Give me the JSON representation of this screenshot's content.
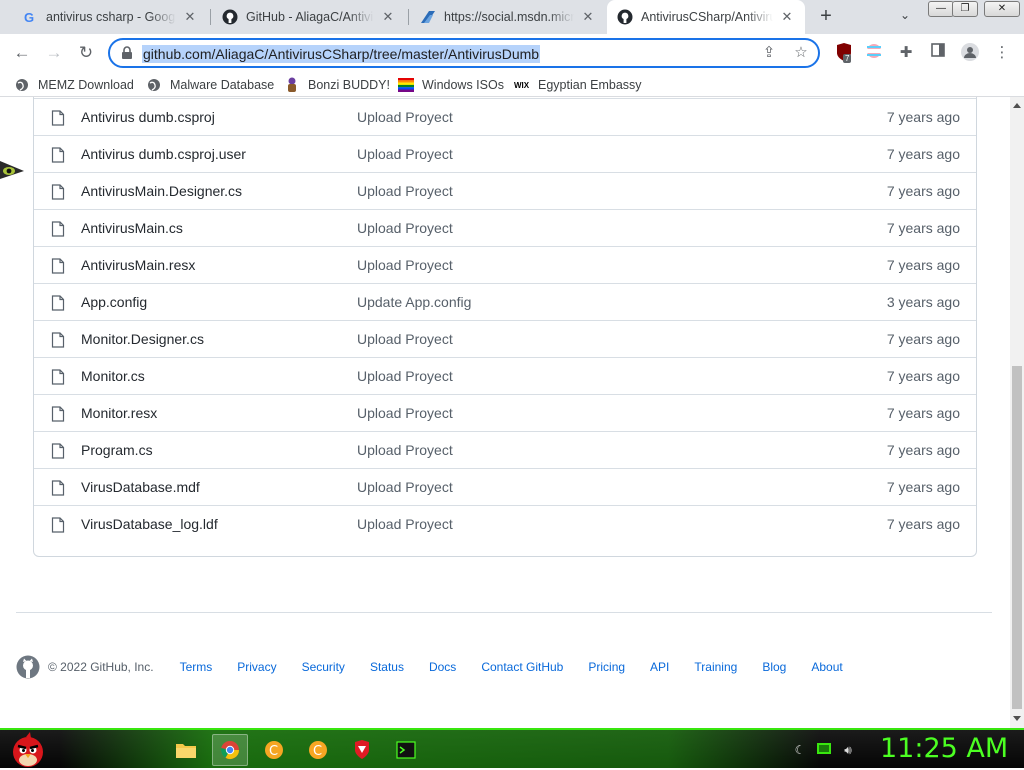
{
  "browser": {
    "tabs": [
      {
        "title": "antivirus csharp - Google",
        "favicon": "google-icon"
      },
      {
        "title": "GitHub - AliagaC/Antivirus",
        "favicon": "github-icon"
      },
      {
        "title": "https://social.msdn.micro",
        "favicon": "msdn-icon"
      },
      {
        "title": "AntivirusCSharp/Antivirus",
        "favicon": "github-icon",
        "active": true
      }
    ],
    "url": "github.com/AliagaC/AntivirusCSharp/tree/master/AntivirusDumb",
    "extension_badge": "7"
  },
  "bookmarks": [
    {
      "label": "MEMZ Download",
      "icon": "globe-icon"
    },
    {
      "label": "Malware Database",
      "icon": "globe-icon"
    },
    {
      "label": "Bonzi BUDDY!",
      "icon": "bonzi-icon"
    },
    {
      "label": "Windows ISOs",
      "icon": "rainbow-flag-icon"
    },
    {
      "label": "Egyptian Embassy",
      "icon": "wix-icon"
    }
  ],
  "files": [
    {
      "name": "Antivirus dumb.csproj",
      "message": "Upload Proyect",
      "age": "7 years ago"
    },
    {
      "name": "Antivirus dumb.csproj.user",
      "message": "Upload Proyect",
      "age": "7 years ago"
    },
    {
      "name": "AntivirusMain.Designer.cs",
      "message": "Upload Proyect",
      "age": "7 years ago"
    },
    {
      "name": "AntivirusMain.cs",
      "message": "Upload Proyect",
      "age": "7 years ago"
    },
    {
      "name": "AntivirusMain.resx",
      "message": "Upload Proyect",
      "age": "7 years ago"
    },
    {
      "name": "App.config",
      "message": "Update App.config",
      "age": "3 years ago"
    },
    {
      "name": "Monitor.Designer.cs",
      "message": "Upload Proyect",
      "age": "7 years ago"
    },
    {
      "name": "Monitor.cs",
      "message": "Upload Proyect",
      "age": "7 years ago"
    },
    {
      "name": "Monitor.resx",
      "message": "Upload Proyect",
      "age": "7 years ago"
    },
    {
      "name": "Program.cs",
      "message": "Upload Proyect",
      "age": "7 years ago"
    },
    {
      "name": "VirusDatabase.mdf",
      "message": "Upload Proyect",
      "age": "7 years ago"
    },
    {
      "name": "VirusDatabase_log.ldf",
      "message": "Upload Proyect",
      "age": "7 years ago"
    }
  ],
  "footer": {
    "copyright": "© 2022 GitHub, Inc.",
    "links": [
      "Terms",
      "Privacy",
      "Security",
      "Status",
      "Docs",
      "Contact GitHub",
      "Pricing",
      "API",
      "Training",
      "Blog",
      "About"
    ]
  },
  "taskbar": {
    "clock": "11:25 AM",
    "accent": "#39e60f",
    "clock_color": "#4cff22"
  },
  "colors": {
    "link": "#0969da",
    "omnibox_focus": "#1a73e8",
    "selection": "#b6d3fb"
  }
}
